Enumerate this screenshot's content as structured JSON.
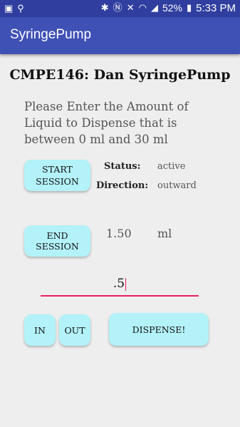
{
  "status_bar": {
    "battery": "52%",
    "time": "5:33 PM",
    "left_icons": [
      "image-icon",
      "usb-icon"
    ],
    "right_icons": [
      "bluetooth-icon",
      "nfc-icon",
      "mute-icon",
      "wifi-icon",
      "signal-icon",
      "battery-icon"
    ]
  },
  "app_bar": {
    "title": "SyringePump"
  },
  "heading": "CMPE146: Dan SyringePump",
  "instructions": "Please Enter the Amount of Liquid to Dispense that is between 0 ml and 30 ml",
  "start_button": "START SESSION",
  "end_button": "END SESSION",
  "status": {
    "label": "Status:",
    "value": "active"
  },
  "direction": {
    "label": "Direction:",
    "value": "outward"
  },
  "amount": {
    "value": "1.50",
    "unit": "ml"
  },
  "input": {
    "value": ".5"
  },
  "in_button": "IN",
  "out_button": "OUT",
  "dispense_button": "DISPENSE!",
  "colors": {
    "status_bar": "#303f9f",
    "app_bar": "#3f51b5",
    "button": "#b3f2f8",
    "accent": "#e91e63"
  }
}
